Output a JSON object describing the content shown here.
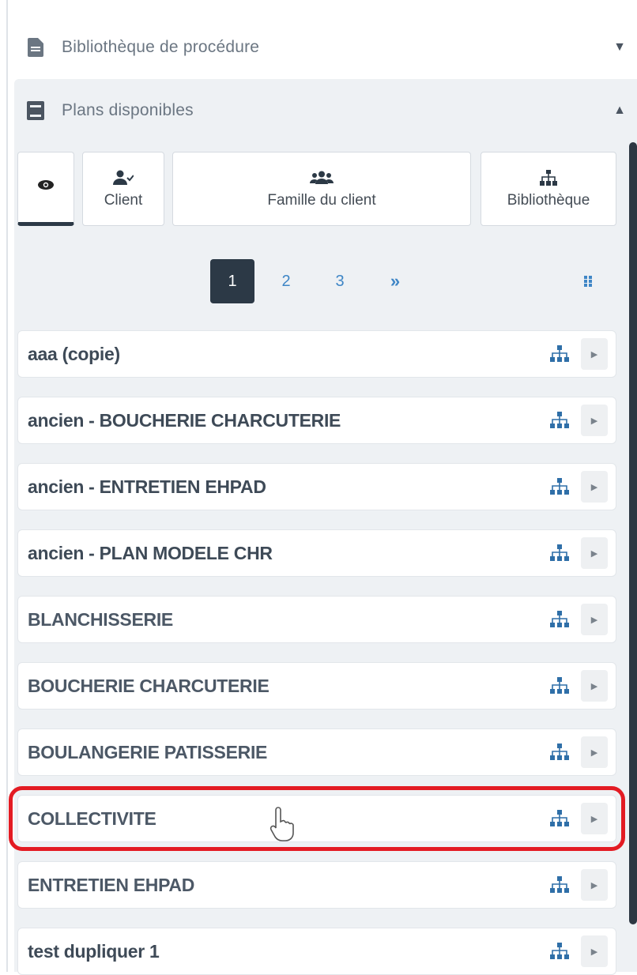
{
  "sections": {
    "procedure_library": {
      "title": "Bibliothèque de procédure",
      "icon": "file-icon",
      "state": "collapsed"
    },
    "available_plans": {
      "title": "Plans disponibles",
      "icon": "book-icon",
      "state": "expanded"
    }
  },
  "filters": [
    {
      "id": "eye",
      "label": "",
      "icon": "eye-icon",
      "active": true
    },
    {
      "id": "client",
      "label": "Client",
      "icon": "user-check-icon",
      "active": false
    },
    {
      "id": "famille",
      "label": "Famille du client",
      "icon": "users-icon",
      "active": false
    },
    {
      "id": "biblio",
      "label": "Bibliothèque",
      "icon": "sitemap-icon",
      "active": false
    }
  ],
  "pagination": {
    "pages": [
      "1",
      "2",
      "3"
    ],
    "current": "1",
    "next_label": "»"
  },
  "plans": [
    "aaa (copie)",
    "ancien - BOUCHERIE CHARCUTERIE",
    "ancien - ENTRETIEN EHPAD",
    "ancien - PLAN MODELE CHR",
    "BLANCHISSERIE",
    "BOUCHERIE CHARCUTERIE",
    "BOULANGERIE PATISSERIE",
    "COLLECTIVITE",
    "ENTRETIEN EHPAD",
    "test dupliquer 1"
  ],
  "highlighted_plan": "COLLECTIVITE",
  "colors": {
    "accent_dark": "#2c3946",
    "link_blue": "#3f86c6",
    "highlight_red": "#e31b23",
    "tree_icon": "#2f6fa8"
  }
}
